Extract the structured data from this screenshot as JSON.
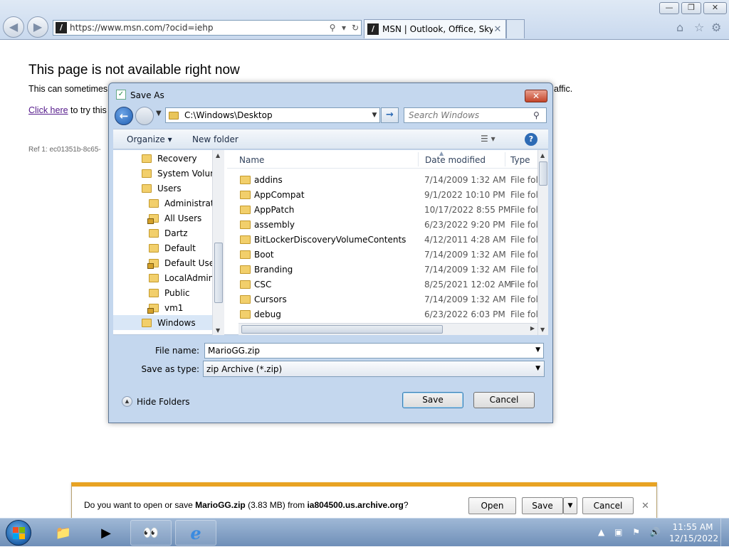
{
  "browser": {
    "url": "https://www.msn.com/?ocid=iehp",
    "tab_title": "MSN | Outlook, Office, Sky...",
    "window_buttons": {
      "minimize": "—",
      "maximize": "❐",
      "close": "✕"
    }
  },
  "page": {
    "heading": "This page is not available right now",
    "line1": "This can sometimes",
    "line1_tail": "affic.",
    "line2_link": "Click here",
    "line2_text": " to try this",
    "ref": "Ref 1: ec01351b-8c65-"
  },
  "dialog": {
    "title": "Save As",
    "path": "C:\\Windows\\Desktop",
    "search_placeholder": "Search Windows",
    "toolbar": {
      "organize": "Organize ▾",
      "new_folder": "New folder"
    },
    "tree": [
      {
        "label": "Recovery",
        "indent": 1,
        "locked": false,
        "selected": false
      },
      {
        "label": "System Volume",
        "indent": 1,
        "locked": false,
        "selected": false
      },
      {
        "label": "Users",
        "indent": 1,
        "locked": false,
        "selected": false
      },
      {
        "label": "Administrato",
        "indent": 2,
        "locked": false,
        "selected": false
      },
      {
        "label": "All Users",
        "indent": 2,
        "locked": true,
        "selected": false
      },
      {
        "label": "Dartz",
        "indent": 2,
        "locked": false,
        "selected": false
      },
      {
        "label": "Default",
        "indent": 2,
        "locked": false,
        "selected": false
      },
      {
        "label": "Default User",
        "indent": 2,
        "locked": true,
        "selected": false
      },
      {
        "label": "LocalAdmin",
        "indent": 2,
        "locked": false,
        "selected": false
      },
      {
        "label": "Public",
        "indent": 2,
        "locked": false,
        "selected": false
      },
      {
        "label": "vm1",
        "indent": 2,
        "locked": true,
        "selected": false
      },
      {
        "label": "Windows",
        "indent": 1,
        "locked": false,
        "selected": true
      }
    ],
    "columns": {
      "name": "Name",
      "date": "Date modified",
      "type": "Type"
    },
    "files": [
      {
        "name": "addins",
        "date": "7/14/2009 1:32 AM",
        "type": "File fol"
      },
      {
        "name": "AppCompat",
        "date": "9/1/2022 10:10 PM",
        "type": "File fol"
      },
      {
        "name": "AppPatch",
        "date": "10/17/2022 8:55 PM",
        "type": "File fol"
      },
      {
        "name": "assembly",
        "date": "6/23/2022 9:20 PM",
        "type": "File fol"
      },
      {
        "name": "BitLockerDiscoveryVolumeContents",
        "date": "4/12/2011 4:28 AM",
        "type": "File fol"
      },
      {
        "name": "Boot",
        "date": "7/14/2009 1:32 AM",
        "type": "File fol"
      },
      {
        "name": "Branding",
        "date": "7/14/2009 1:32 AM",
        "type": "File fol"
      },
      {
        "name": "CSC",
        "date": "8/25/2021 12:02 AM",
        "type": "File fol"
      },
      {
        "name": "Cursors",
        "date": "7/14/2009 1:32 AM",
        "type": "File fol"
      },
      {
        "name": "debug",
        "date": "6/23/2022 6:03 PM",
        "type": "File fol"
      }
    ],
    "file_name_label": "File name:",
    "file_name_value": "MarioGG.zip",
    "save_type_label": "Save as type:",
    "save_type_value": "zip Archive (*.zip)",
    "hide_folders": "Hide Folders",
    "save_button": "Save",
    "cancel_button": "Cancel"
  },
  "download_bar": {
    "prefix": "Do you want to open or save ",
    "file": "MarioGG.zip",
    "size": " (3.83 MB) from ",
    "host": "ia804500.us.archive.org",
    "suffix": "?",
    "open": "Open",
    "save": "Save",
    "cancel": "Cancel"
  },
  "taskbar": {
    "time": "11:55 AM",
    "date": "12/15/2022"
  },
  "colors": {
    "accent": "#2d6bb5",
    "notification": "#e8a323",
    "dialog_frame": "#c4d7ee"
  }
}
